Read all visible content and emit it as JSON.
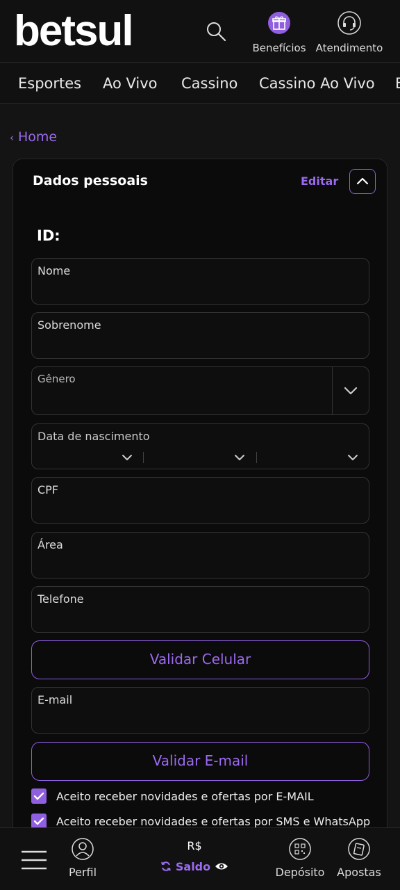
{
  "header": {
    "logo": "betsul",
    "beneficios_label": "Benefícios",
    "atendimento_label": "Atendimento"
  },
  "nav": {
    "items": [
      "Esportes",
      "Ao Vivo",
      "Cassino",
      "Cassino Ao Vivo",
      "E"
    ]
  },
  "breadcrumb": {
    "home": "Home"
  },
  "card": {
    "title": "Dados pessoais",
    "edit_label": "Editar",
    "id_label": "ID:",
    "fields": {
      "nome": "Nome",
      "sobrenome": "Sobrenome",
      "genero": "Gênero",
      "nascimento": "Data de nascimento",
      "cpf": "CPF",
      "area": "Área",
      "telefone": "Telefone",
      "email": "E-mail"
    },
    "validar_celular": "Validar Celular",
    "validar_email": "Validar E-mail",
    "checkbox_email": "Aceito receber novidades e ofertas por E-MAIL",
    "checkbox_sms": "Aceito receber novidades e ofertas por SMS e WhatsApp"
  },
  "bottom": {
    "perfil": "Perfil",
    "currency": "R$",
    "saldo": "Saldo",
    "deposito": "Depósito",
    "apostas": "Apostas"
  },
  "colors": {
    "accent": "#8f5fe0",
    "background": "#141414"
  }
}
